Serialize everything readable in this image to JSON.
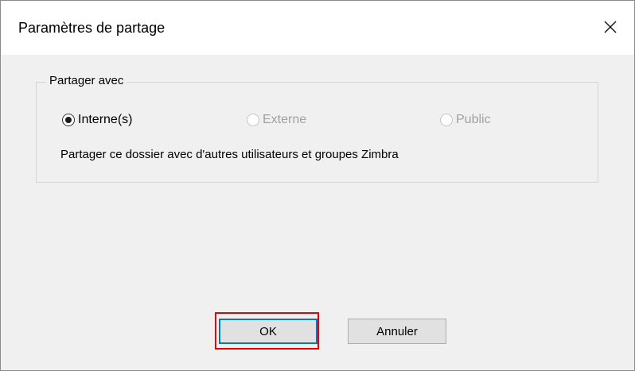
{
  "dialog": {
    "title": "Paramètres de partage"
  },
  "share_group": {
    "legend": "Partager avec",
    "options": [
      {
        "label": "Interne(s)",
        "selected": true,
        "enabled": true
      },
      {
        "label": "Externe",
        "selected": false,
        "enabled": false
      },
      {
        "label": "Public",
        "selected": false,
        "enabled": false
      }
    ],
    "description": "Partager ce dossier avec d'autres utilisateurs et groupes Zimbra"
  },
  "buttons": {
    "ok_label": "OK",
    "cancel_label": "Annuler"
  },
  "colors": {
    "highlight": "#e60000",
    "focus_border": "#0078d7"
  },
  "icons": {
    "close": "close-icon"
  }
}
